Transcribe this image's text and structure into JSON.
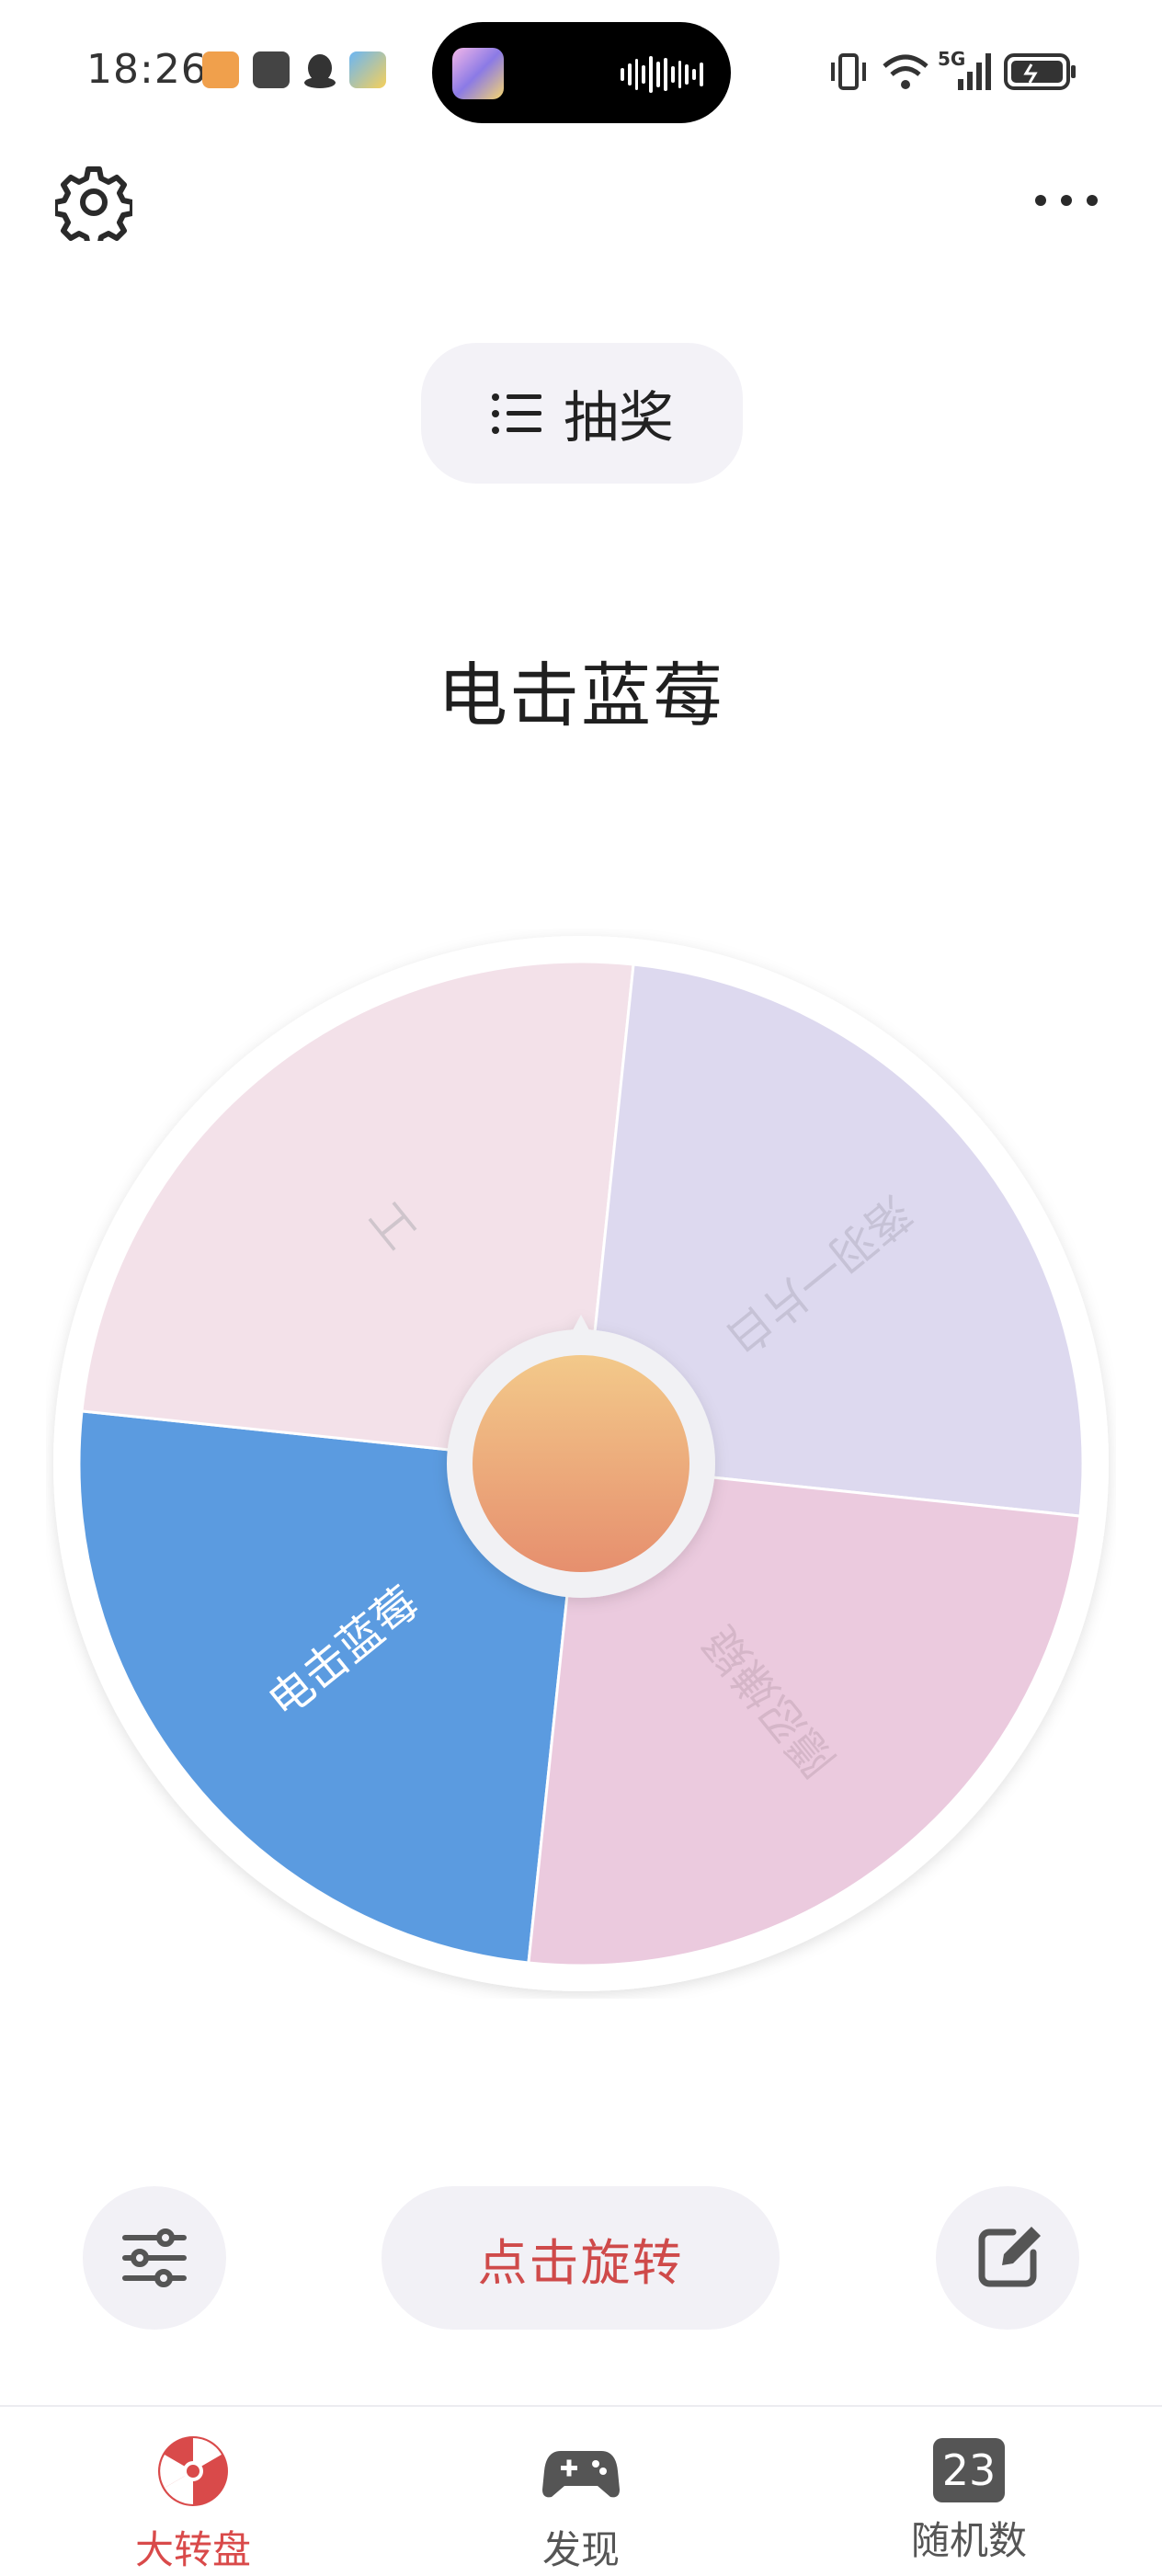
{
  "status_bar": {
    "time": "18:26",
    "network": "5G",
    "island_icons": [
      "game-app-icon",
      "audio-wave-icon"
    ]
  },
  "header": {
    "settings_icon": "gear-icon",
    "more_icon": "more-dots-icon"
  },
  "mode_button": {
    "icon": "list-icon",
    "label": "抽奖"
  },
  "result_text": "电击蓝莓",
  "wheel": {
    "segments": [
      {
        "label": "电击蓝莓",
        "color": "#5b9be0",
        "text_color": "#ffffff"
      },
      {
        "label": "工",
        "color": "#f3e1e9",
        "text_color": "#cfc5cc"
      },
      {
        "label": "落羽一片白",
        "color": "#ddd9ef",
        "text_color": "#c6c2d6"
      },
      {
        "label": "隱忍嫌疑",
        "color": "#ebcade",
        "text_color": "#d5b6c8"
      }
    ],
    "center_gradient": [
      "#f3c98a",
      "#e68f6e"
    ]
  },
  "controls": {
    "left_icon": "sliders-icon",
    "spin_label": "点击旋转",
    "right_icon": "edit-icon",
    "accent": "#cf4a4a"
  },
  "tabbar": {
    "tabs": [
      {
        "label": "大转盘",
        "icon": "wheel-icon",
        "active": true
      },
      {
        "label": "发现",
        "icon": "gamepad-icon",
        "active": false
      },
      {
        "label": "随机数",
        "icon": "number-23-icon",
        "badge": "23",
        "active": false
      }
    ],
    "active_color": "#d94a4a",
    "inactive_color": "#555555"
  }
}
